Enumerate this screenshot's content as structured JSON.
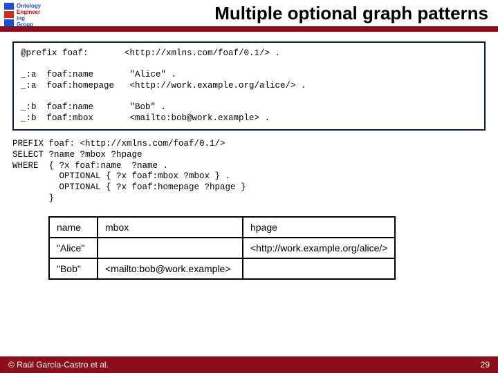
{
  "title": "Multiple optional graph patterns",
  "logo_lines": [
    "Ontology",
    "Engineer",
    "ing Group"
  ],
  "rdf_box": "@prefix foaf:       <http://xmlns.com/foaf/0.1/> .\n\n_:a  foaf:name       \"Alice\" .\n_:a  foaf:homepage   <http://work.example.org/alice/> .\n\n_:b  foaf:name       \"Bob\" .\n_:b  foaf:mbox       <mailto:bob@work.example> .",
  "sparql": "PREFIX foaf: <http://xmlns.com/foaf/0.1/>\nSELECT ?name ?mbox ?hpage\nWHERE  { ?x foaf:name  ?name .\n         OPTIONAL { ?x foaf:mbox ?mbox } .\n         OPTIONAL { ?x foaf:homepage ?hpage }\n       }",
  "table": {
    "headers": [
      "name",
      "mbox",
      "hpage"
    ],
    "rows": [
      [
        "\"Alice\"",
        "",
        "<http://work.example.org/alice/>"
      ],
      [
        "\"Bob\"",
        "<mailto:bob@work.example>",
        ""
      ]
    ]
  },
  "footer_left": "© Raúl García-Castro et al.",
  "footer_right": "29"
}
